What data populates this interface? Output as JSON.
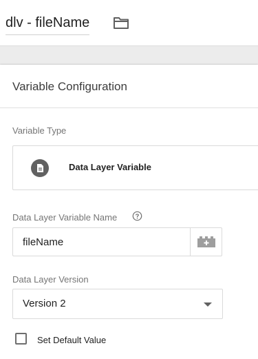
{
  "header": {
    "variable_name": "dlv - fileName",
    "folder_icon": "folder-icon"
  },
  "config": {
    "section_title": "Variable Configuration",
    "variable_type": {
      "label": "Variable Type",
      "value": "Data Layer Variable",
      "icon": "document-icon"
    },
    "data_layer_variable_name": {
      "label": "Data Layer Variable Name",
      "value": "fileName",
      "help_icon": "help-icon",
      "picker_icon": "variable-picker-icon"
    },
    "data_layer_version": {
      "label": "Data Layer Version",
      "selected": "Version 2"
    },
    "default_value": {
      "label": "Set Default Value",
      "checked": false
    }
  },
  "colors": {
    "background": "#ececec",
    "card": "#ffffff",
    "border": "#dadada",
    "icon_gray": "#616161",
    "label_gray": "#757575"
  }
}
